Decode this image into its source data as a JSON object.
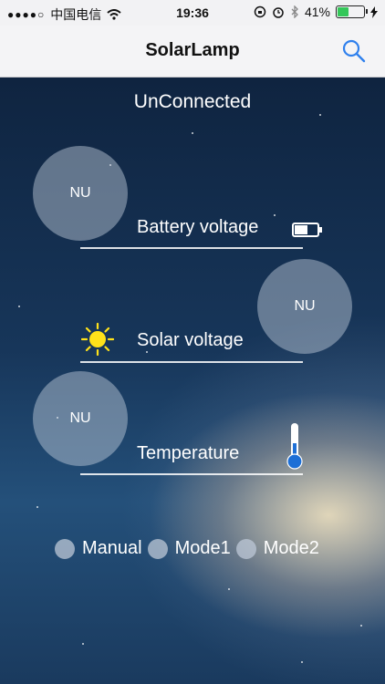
{
  "status_bar": {
    "signal_dots": "●●●●○",
    "carrier": "中国电信",
    "time": "19:36",
    "battery_percent": "41%",
    "battery_level": 0.41
  },
  "nav": {
    "title": "SolarLamp",
    "search_icon": "search-icon"
  },
  "connection_status": "UnConnected",
  "readings": {
    "battery": {
      "value": "NU",
      "label": "Battery voltage",
      "icon": "battery-icon"
    },
    "solar": {
      "value": "NU",
      "label": "Solar voltage",
      "icon": "sun-icon"
    },
    "temperature": {
      "value": "NU",
      "label": "Temperature",
      "icon": "thermometer-icon"
    }
  },
  "modes": [
    {
      "label": "Manual"
    },
    {
      "label": "Mode1"
    },
    {
      "label": "Mode2"
    }
  ],
  "colors": {
    "accent": "#2f80ed",
    "battery_green": "#34c759"
  }
}
